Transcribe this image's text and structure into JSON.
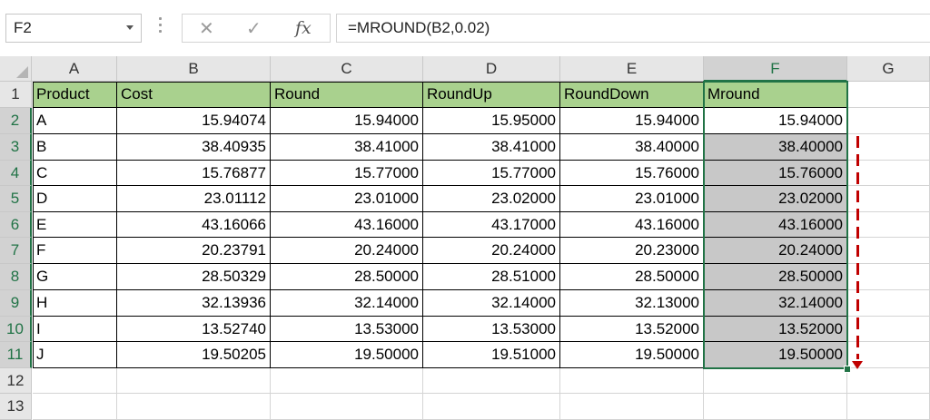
{
  "formula_bar": {
    "name_box": "F2",
    "cancel_glyph": "✕",
    "enter_glyph": "✓",
    "fx_label": "fx",
    "formula": "=MROUND(B2,0.02)"
  },
  "columns": [
    "A",
    "B",
    "C",
    "D",
    "E",
    "F",
    "G"
  ],
  "rows": [
    "1",
    "2",
    "3",
    "4",
    "5",
    "6",
    "7",
    "8",
    "9",
    "10",
    "11",
    "12",
    "13"
  ],
  "table": {
    "headers": [
      "Product",
      "Cost",
      "Round",
      "RoundUp",
      "RoundDown",
      "Mround"
    ],
    "rows": [
      [
        "A",
        "15.94074",
        "15.94000",
        "15.95000",
        "15.94000",
        "15.94000"
      ],
      [
        "B",
        "38.40935",
        "38.41000",
        "38.41000",
        "38.40000",
        "38.40000"
      ],
      [
        "C",
        "15.76877",
        "15.77000",
        "15.77000",
        "15.76000",
        "15.76000"
      ],
      [
        "D",
        "23.01112",
        "23.01000",
        "23.02000",
        "23.01000",
        "23.02000"
      ],
      [
        "E",
        "43.16066",
        "43.16000",
        "43.17000",
        "43.16000",
        "43.16000"
      ],
      [
        "F",
        "20.23791",
        "20.24000",
        "20.24000",
        "20.23000",
        "20.24000"
      ],
      [
        "G",
        "28.50329",
        "28.50000",
        "28.51000",
        "28.50000",
        "28.50000"
      ],
      [
        "H",
        "32.13936",
        "32.14000",
        "32.14000",
        "32.13000",
        "32.14000"
      ],
      [
        "I",
        "13.52740",
        "13.53000",
        "13.53000",
        "13.52000",
        "13.52000"
      ],
      [
        "J",
        "19.50205",
        "19.50000",
        "19.51000",
        "19.50000",
        "19.50000"
      ]
    ]
  },
  "selection": {
    "active_cell": "F2",
    "selected_column": "F",
    "range": "F2:F11"
  },
  "colors": {
    "header_fill": "#a9d18e",
    "selection_green": "#217346",
    "fill_gray": "#c8c8c8",
    "arrow_red": "#c00000"
  }
}
